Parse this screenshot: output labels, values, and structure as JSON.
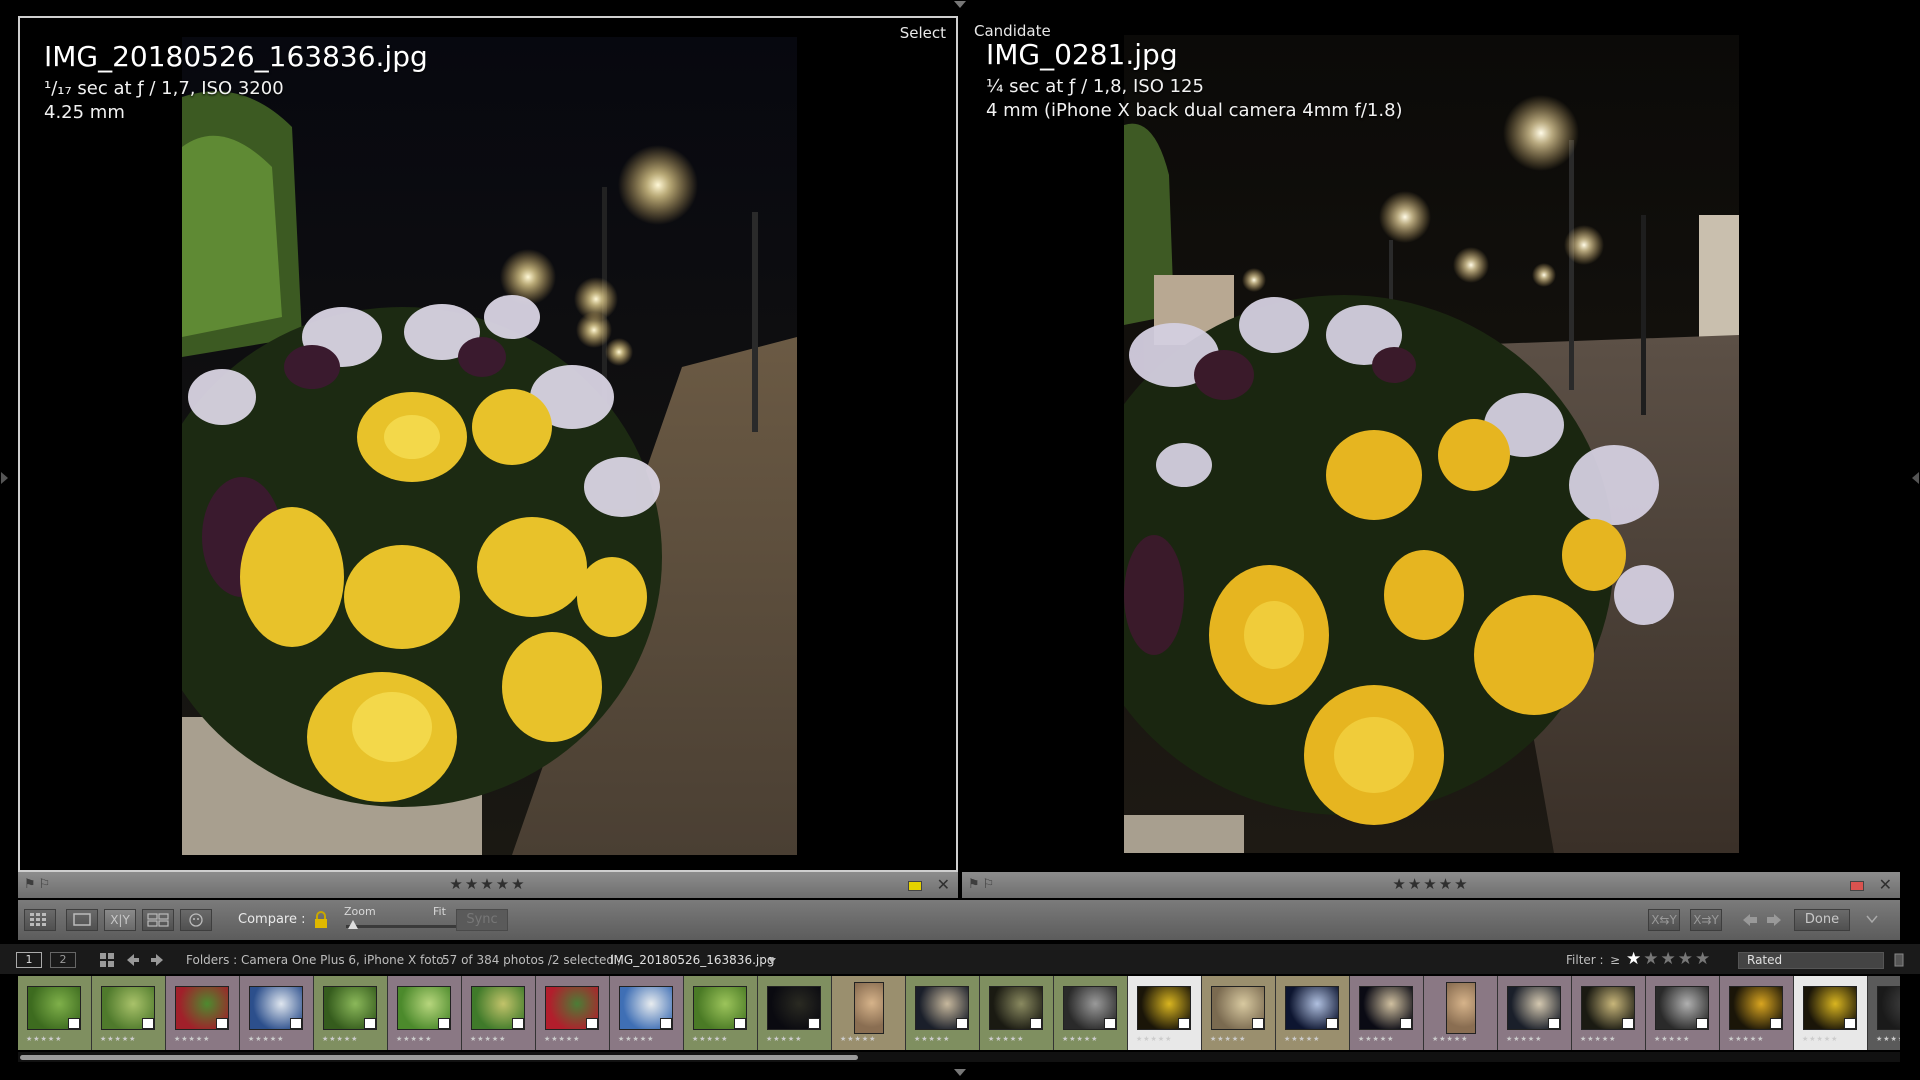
{
  "left_pane": {
    "label": "Select",
    "filename": "IMG_20180526_163836.jpg",
    "exposure": "¹/₁₇ sec at ƒ / 1,7, ISO 3200",
    "focal": "4.25 mm",
    "rating": "★★★★★",
    "color_label": "#e5d200"
  },
  "right_pane": {
    "label": "Candidate",
    "filename": "IMG_0281.jpg",
    "exposure": "¼ sec at ƒ / 1,8, ISO 125",
    "focal": "4 mm (iPhone X back dual camera 4mm f/1.8)",
    "rating": "★★★★★",
    "color_label": "#d9534f"
  },
  "toolbar": {
    "compare_label": "Compare :",
    "zoom_label": "Zoom",
    "fit_label": "Fit",
    "sync_label": "Sync",
    "done_label": "Done",
    "xy_label": "X|Y",
    "swap_label": "X⇆Y",
    "select_swap_label": "X⇉Y"
  },
  "filmstrip_header": {
    "page1": "1",
    "page2": "2",
    "path": "Folders : Camera One Plus 6, iPhone X foto",
    "count": "57 of 384 photos /2 selected /",
    "current": "IMG_20180526_163836.jpg",
    "filter_label": "Filter :",
    "filter_op": "≥",
    "filter_stars": "★★★★★",
    "rated": "Rated"
  },
  "filmstrip": {
    "stars": "★★★★★",
    "cells": [
      {
        "bg": "#7f8f60",
        "colors": [
          "#3d6b1f",
          "#7fb04a"
        ]
      },
      {
        "bg": "#7f8f60",
        "colors": [
          "#4f7a2c",
          "#a9c26a"
        ]
      },
      {
        "bg": "#8a7884",
        "colors": [
          "#a1202a",
          "#4d8a2f"
        ]
      },
      {
        "bg": "#8a7884",
        "colors": [
          "#2c4f8c",
          "#dfe6ef"
        ]
      },
      {
        "bg": "#7f8f60",
        "colors": [
          "#355c1d",
          "#8bb85a"
        ]
      },
      {
        "bg": "#8a7884",
        "colors": [
          "#4c8a2c",
          "#b7d67d"
        ]
      },
      {
        "bg": "#8a7884",
        "colors": [
          "#3f7a2a",
          "#c2c36a"
        ]
      },
      {
        "bg": "#8a7884",
        "colors": [
          "#b21e2c",
          "#4b7d36"
        ]
      },
      {
        "bg": "#8a7884",
        "colors": [
          "#3f6fb5",
          "#e8ecef"
        ]
      },
      {
        "bg": "#7f8f60",
        "colors": [
          "#4a7a25",
          "#9cc45b"
        ]
      },
      {
        "bg": "#7f8f60",
        "colors": [
          "#0a0a10",
          "#2a2a22"
        ]
      },
      {
        "bg": "#9a8f6e",
        "colors": [
          "#8a6e52",
          "#d6b38a"
        ]
      },
      {
        "bg": "#7f8f60",
        "colors": [
          "#1a1f2a",
          "#c7b89d"
        ]
      },
      {
        "bg": "#7f8f60",
        "colors": [
          "#1a1a12",
          "#8a8a60"
        ]
      },
      {
        "bg": "#7f8f60",
        "colors": [
          "#2a2a2a",
          "#9a9a9a"
        ]
      },
      {
        "bg": "#e8e8e8",
        "colors": [
          "#1a1508",
          "#d9b520"
        ]
      },
      {
        "bg": "#9a8f6e",
        "colors": [
          "#7a6a50",
          "#d8c9a0"
        ]
      },
      {
        "bg": "#9a8f6e",
        "colors": [
          "#0d1530",
          "#b0c0e0"
        ]
      },
      {
        "bg": "#8a7884",
        "colors": [
          "#0a0a14",
          "#d0c0a0"
        ]
      },
      {
        "bg": "#8a7884",
        "colors": [
          "#8a6e52",
          "#d6b38a"
        ]
      },
      {
        "bg": "#8a7884",
        "colors": [
          "#1a1f2a",
          "#d4c8b0"
        ]
      },
      {
        "bg": "#8a7884",
        "colors": [
          "#1a1a12",
          "#c8b67a"
        ]
      },
      {
        "bg": "#8a7884",
        "colors": [
          "#2a2a2a",
          "#b0b0b0"
        ]
      },
      {
        "bg": "#8a7884",
        "colors": [
          "#1a1508",
          "#d9a520"
        ]
      },
      {
        "bg": "#e8e8e8",
        "colors": [
          "#1a1508",
          "#d9b520"
        ]
      },
      {
        "bg": "#5a5a5a",
        "colors": [
          "#1a1a1a",
          "#444"
        ]
      }
    ]
  }
}
